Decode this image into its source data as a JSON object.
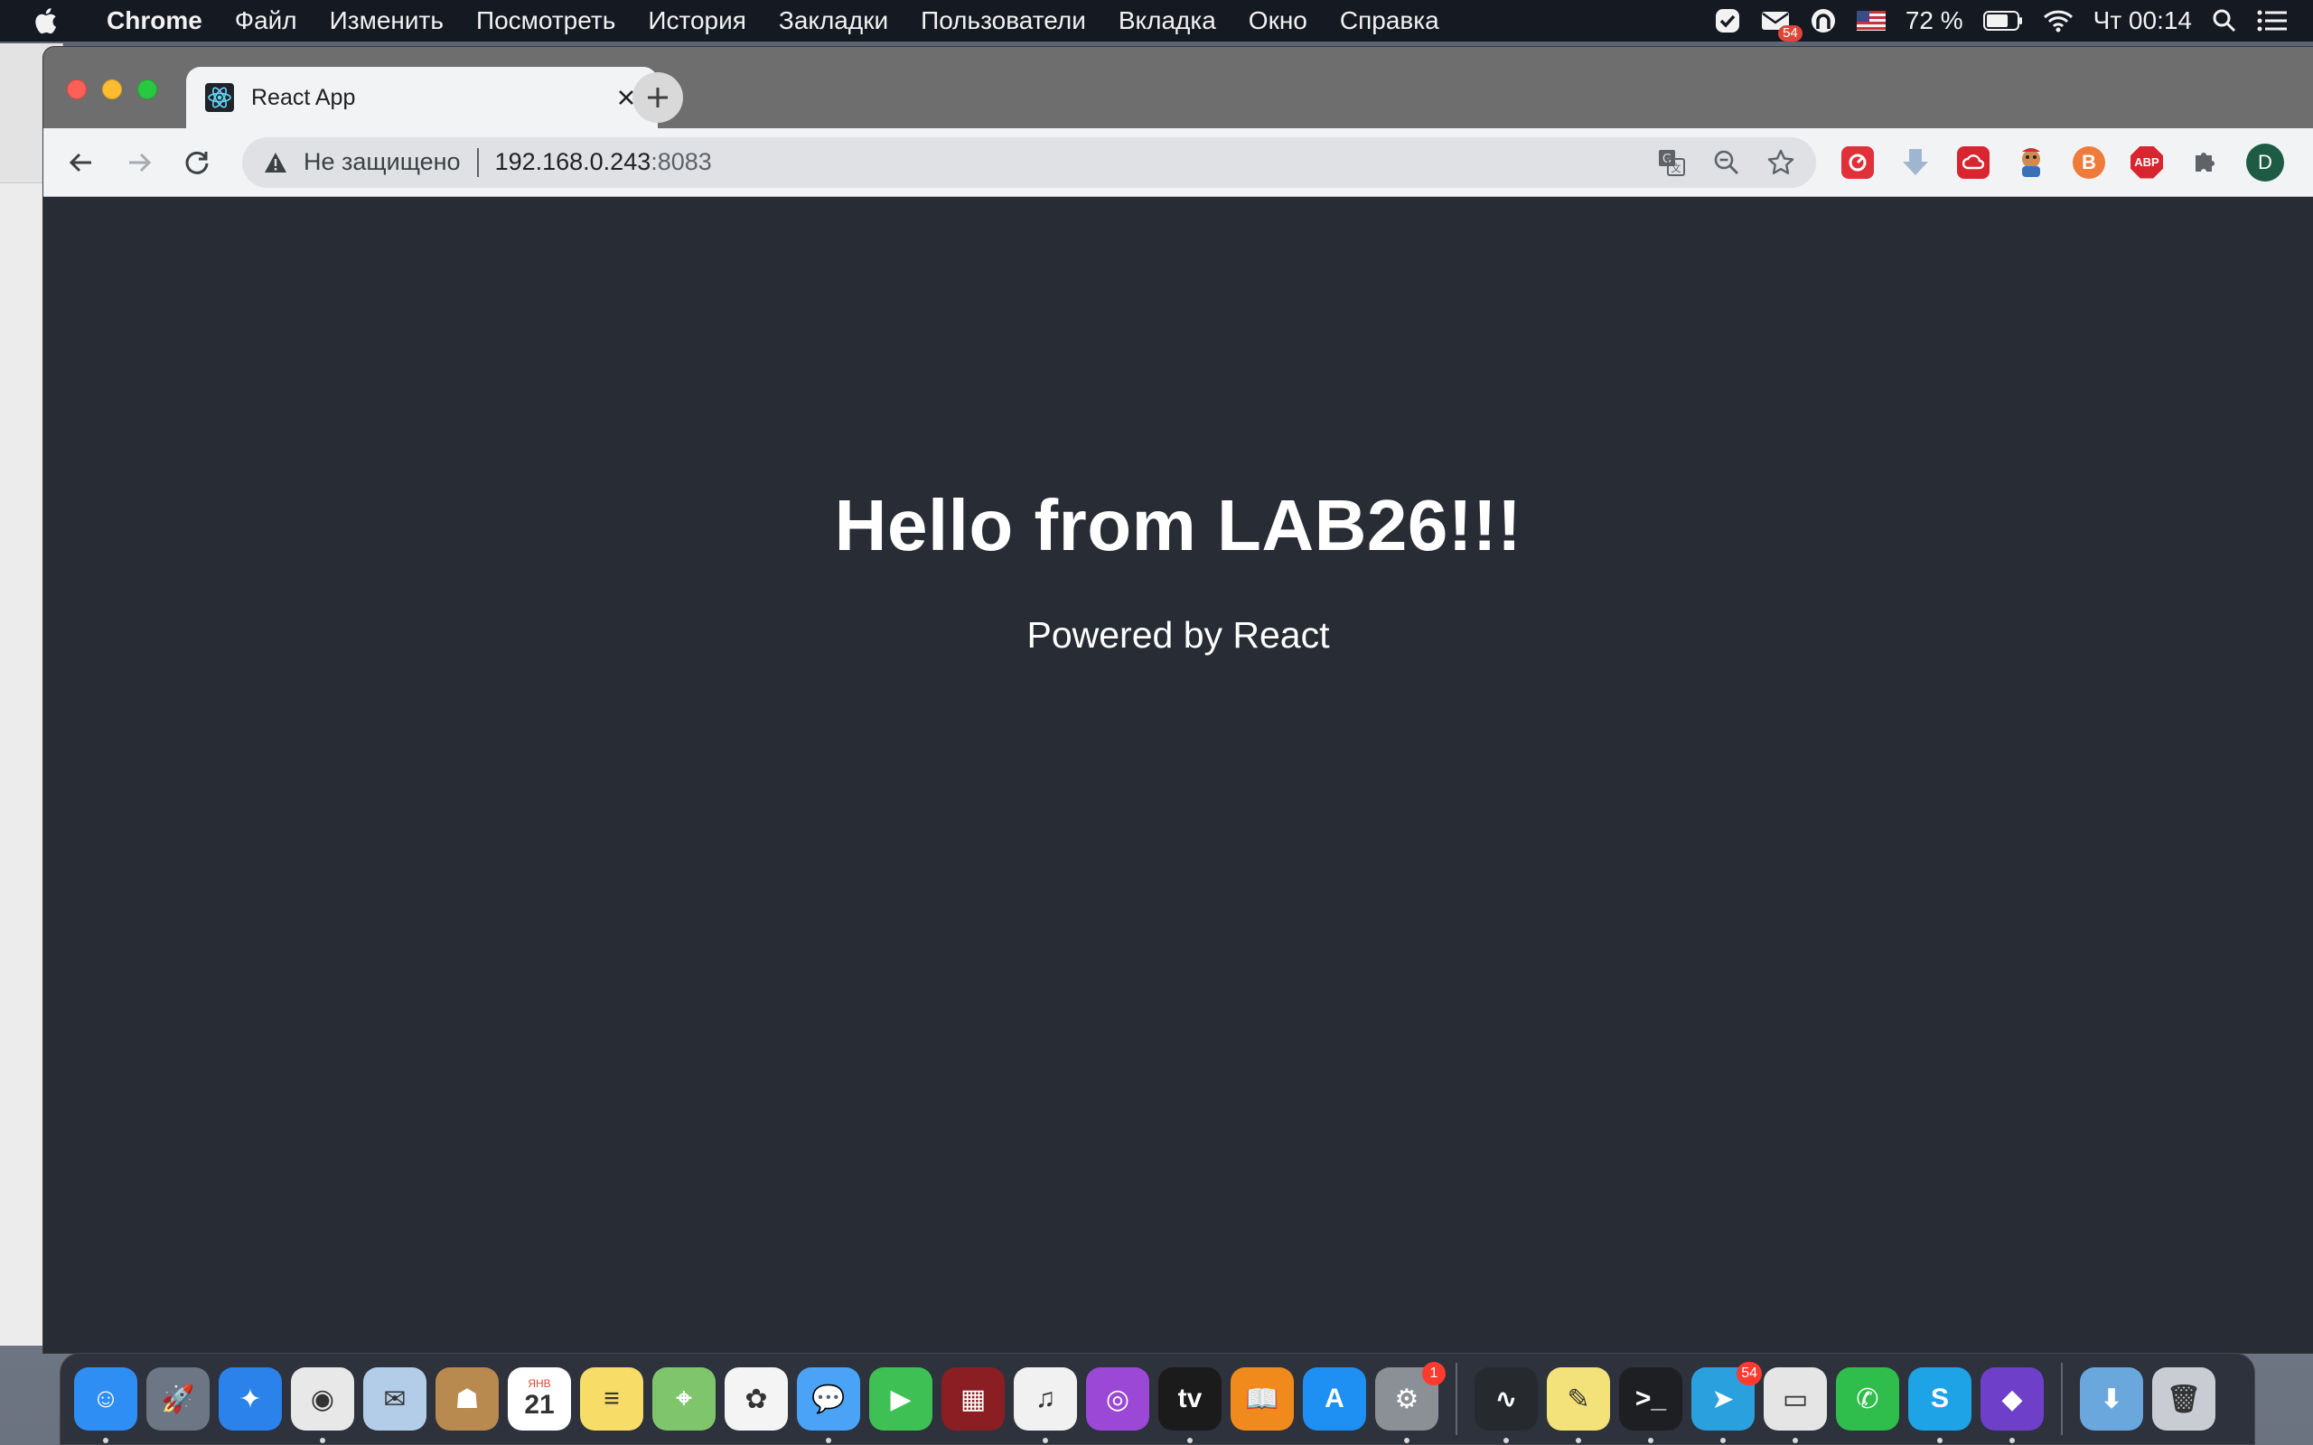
{
  "menubar": {
    "app_name": "Chrome",
    "items": [
      "Файл",
      "Изменить",
      "Посмотреть",
      "История",
      "Закладки",
      "Пользователи",
      "Вкладка",
      "Окно",
      "Справка"
    ],
    "status": {
      "mail_badge": "54",
      "battery_percent": "72 %",
      "battery_level": 0.72,
      "clock": "Чт 00:14"
    }
  },
  "browser": {
    "tab_title": "React App",
    "security_text": "Не защищено",
    "url_host": "192.168.0.243",
    "url_port": ":8083",
    "profile_initial": "D",
    "extensions": [
      {
        "name": "red-circle-extension-icon",
        "color": "#e0303a"
      },
      {
        "name": "download-arrow-extension-icon",
        "color": "#9fb6d1"
      },
      {
        "name": "cloud-extension-icon",
        "color": "#d9252f"
      },
      {
        "name": "cartoon-character-extension-icon",
        "color": "#b6733a"
      },
      {
        "name": "b-logo-extension-icon",
        "color": "#f07a3a"
      },
      {
        "name": "adblock-extension-icon",
        "color": "#d9252f",
        "label": "ABP"
      },
      {
        "name": "puzzle-extensions-icon",
        "color": "#5f6368"
      }
    ]
  },
  "page": {
    "heading": "Hello from LAB26!!!",
    "subtitle": "Powered by React",
    "background": "#282c34"
  },
  "dock": {
    "apps_left": [
      {
        "name": "finder",
        "color": "#2f8ef4",
        "glyph": "☺",
        "running": true
      },
      {
        "name": "launchpad",
        "color": "#6d7684",
        "glyph": "🚀",
        "running": false
      },
      {
        "name": "safari",
        "color": "#2a82ea",
        "glyph": "✦",
        "running": false
      },
      {
        "name": "chrome",
        "color": "#e8e8e8",
        "glyph": "◉",
        "running": true
      },
      {
        "name": "mail",
        "color": "#b3cde8",
        "glyph": "✉",
        "running": false
      },
      {
        "name": "contacts",
        "color": "#b98a4f",
        "glyph": "☗",
        "running": false
      },
      {
        "name": "calendar",
        "color": "#ffffff",
        "glyph": "21",
        "label": "ЯНВ",
        "running": false
      },
      {
        "name": "notes",
        "color": "#f7dc68",
        "glyph": "≡",
        "running": false
      },
      {
        "name": "maps",
        "color": "#7fc56b",
        "glyph": "⌖",
        "running": false
      },
      {
        "name": "photos",
        "color": "#f4f4f4",
        "glyph": "✿",
        "running": false
      },
      {
        "name": "messages",
        "color": "#4aa3f7",
        "glyph": "💬",
        "running": true
      },
      {
        "name": "facetime",
        "color": "#3fc054",
        "glyph": "▶",
        "running": false
      },
      {
        "name": "photo-booth",
        "color": "#8a1e22",
        "glyph": "▦",
        "running": false
      },
      {
        "name": "music",
        "color": "#f1f1f1",
        "glyph": "♫",
        "running": true
      },
      {
        "name": "podcasts",
        "color": "#9b48d6",
        "glyph": "◎",
        "running": false
      },
      {
        "name": "apple-tv",
        "color": "#1b1b1b",
        "glyph": "tv",
        "running": true
      },
      {
        "name": "books",
        "color": "#f08a1c",
        "glyph": "📖",
        "running": false
      },
      {
        "name": "app-store",
        "color": "#1e8ff3",
        "glyph": "A",
        "running": false
      },
      {
        "name": "system-preferences",
        "color": "#8b8f96",
        "glyph": "⚙",
        "badge": "1",
        "running": true
      }
    ],
    "apps_right": [
      {
        "name": "activity-monitor",
        "color": "#262a2f",
        "glyph": "∿",
        "running": true
      },
      {
        "name": "stickies",
        "color": "#f3e27a",
        "glyph": "✎",
        "running": true
      },
      {
        "name": "terminal",
        "color": "#1d1f22",
        "glyph": ">_",
        "running": true
      },
      {
        "name": "telegram",
        "color": "#2aa1de",
        "glyph": "➤",
        "badge": "54",
        "running": true
      },
      {
        "name": "printer",
        "color": "#e5e5e5",
        "glyph": "▭",
        "running": true
      },
      {
        "name": "whatsapp",
        "color": "#2fbd4c",
        "glyph": "✆",
        "running": false
      },
      {
        "name": "skype",
        "color": "#1ea3e6",
        "glyph": "S",
        "running": true
      },
      {
        "name": "github-desktop",
        "color": "#6e40c9",
        "glyph": "◆",
        "running": true
      }
    ],
    "apps_trailing": [
      {
        "name": "downloads-folder",
        "color": "#6aa7dc",
        "glyph": "⬇",
        "running": false
      },
      {
        "name": "trash",
        "color": "#c9cdd3",
        "glyph": "🗑",
        "running": false
      }
    ]
  }
}
